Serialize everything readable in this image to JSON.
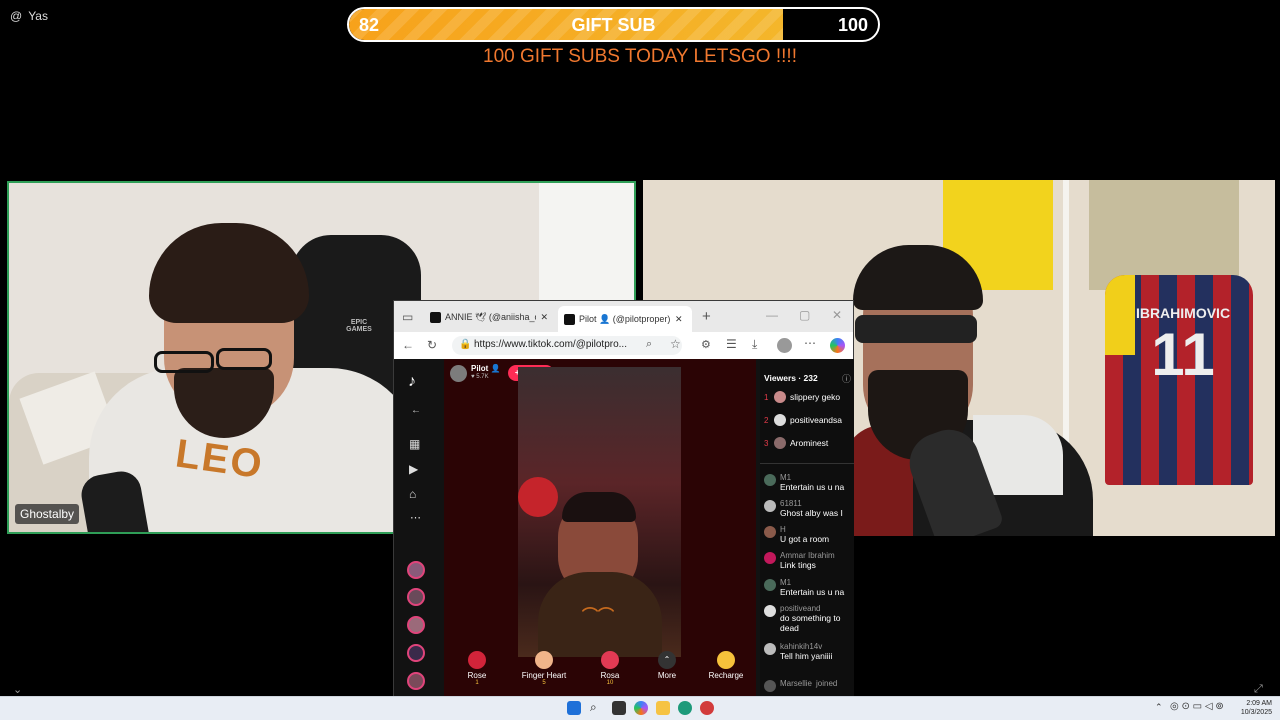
{
  "overlay": {
    "user_handle": "Yas",
    "gift_progress": {
      "current": "82",
      "label": "GIFT SUB",
      "goal": "100",
      "fill_fraction": 0.82
    },
    "banner_text": "100 GIFT SUBS TODAY LETSGO !!!!",
    "colors": {
      "bar_fill": "#f7a21b",
      "banner": "#f0782f",
      "active_speaker_border": "#2f9e57"
    }
  },
  "cameras": {
    "left_name": "Ghostalby"
  },
  "browser": {
    "tabs": [
      {
        "label": "ANNIE 🕊 (@aniisha_ox)"
      },
      {
        "label": "Pilot 👤 (@pilotproper)"
      }
    ],
    "new_tab_symbol": "+",
    "url": "https://www.tiktok.com/@pilotpro...",
    "tiktok": {
      "host_name": "Pilot 👤",
      "host_likes": "♥ 5.7K",
      "follow_label": "+ Follow",
      "viewers_title": "Viewers · 232",
      "top_viewers": [
        {
          "rank": "1",
          "name": "slippery geko"
        },
        {
          "rank": "2",
          "name": "positiveandsa"
        },
        {
          "rank": "3",
          "name": "Arominest"
        }
      ],
      "messages": [
        {
          "user": "M1",
          "text": "Entertain us u na"
        },
        {
          "user": "61811",
          "text": "Ghost alby was I"
        },
        {
          "user": "H",
          "text": "U got a room"
        },
        {
          "user": "Ammar Ibrahim",
          "text": "Link tings"
        },
        {
          "user": "M1",
          "text": "Entertain us u na"
        },
        {
          "user": "positiveand",
          "text": "do something to dead"
        },
        {
          "user": "kahinkih14v",
          "text": "Tell him yaniiii"
        },
        {
          "user": "Marsellie",
          "text": "joined"
        }
      ],
      "gifts": [
        {
          "name": "Rose",
          "cost": "1"
        },
        {
          "name": "Finger Heart",
          "cost": "5"
        },
        {
          "name": "Rosa",
          "cost": "10"
        }
      ],
      "more_label": "More",
      "recharge_label": "Recharge"
    }
  },
  "taskbar": {
    "time": "2:09 AM",
    "date": "10/3/2025"
  }
}
